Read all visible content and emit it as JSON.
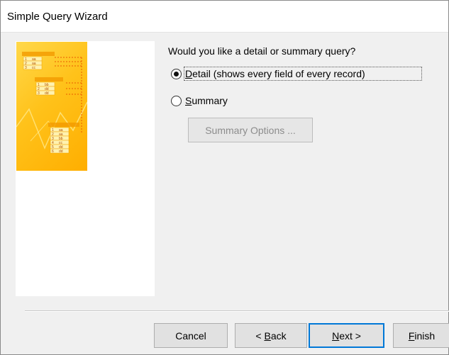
{
  "window": {
    "title": "Simple Query Wizard"
  },
  "question": "Would you like a detail or summary query?",
  "options": [
    {
      "label_key": "D",
      "label_rest": "etail (shows every field of every record)",
      "checked": true
    },
    {
      "label_key": "S",
      "label_rest": "ummary",
      "checked": false
    }
  ],
  "summary_options_label": "Summary Options ...",
  "buttons": {
    "cancel": "Cancel",
    "back_prefix": "< ",
    "back_key": "B",
    "back_rest": "ack",
    "next_key": "N",
    "next_rest": "ext >",
    "finish_key": "F",
    "finish_rest": "inish"
  },
  "illustration": {
    "table1": [
      [
        "1",
        "aa"
      ],
      [
        "2",
        "aa"
      ],
      [
        "3",
        "cc"
      ]
    ],
    "table2": [
      [
        "1",
        "bb"
      ],
      [
        "2",
        "dd"
      ],
      [
        "3",
        "dd"
      ]
    ],
    "table3": [
      [
        "1",
        "aa"
      ],
      [
        "2",
        "aa"
      ],
      [
        "3",
        "bb"
      ],
      [
        "4",
        "cc"
      ],
      [
        "5",
        "dd"
      ],
      [
        "6",
        "dd"
      ]
    ]
  },
  "colors": {
    "accent": "#0078d7",
    "illustration": "#ffc21a"
  }
}
